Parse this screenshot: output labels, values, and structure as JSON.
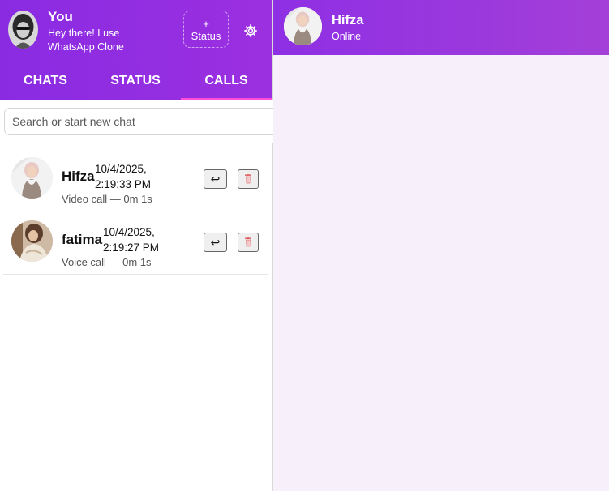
{
  "profile": {
    "name": "You",
    "status": "Hey there! I use WhatsApp Clone",
    "status_button": "+\nStatus"
  },
  "tabs": [
    {
      "label": "CHATS",
      "active": false
    },
    {
      "label": "STATUS",
      "active": false
    },
    {
      "label": "CALLS",
      "active": true
    }
  ],
  "search": {
    "placeholder": "Search or start new chat",
    "value": ""
  },
  "calls": [
    {
      "name": "Hifza",
      "time_line1": "10/4/2025,",
      "time_line2": "2:19:33 PM",
      "detail": "Video call — 0m 1s"
    },
    {
      "name": "fatima",
      "time_line1": "10/4/2025,",
      "time_line2": "2:19:27 PM",
      "detail": "Voice call — 0m 1s"
    }
  ],
  "active_chat": {
    "name": "Hifza",
    "status": "Online"
  },
  "icons": {
    "settings": "gear-icon",
    "redial": "redial-arrow-icon",
    "delete": "trash-icon"
  },
  "colors": {
    "header_purple": "#8a2be2",
    "active_tab_underline": "#ff4fd8",
    "chat_background": "#f7f0fa",
    "trash_red": "#e06a6a"
  }
}
